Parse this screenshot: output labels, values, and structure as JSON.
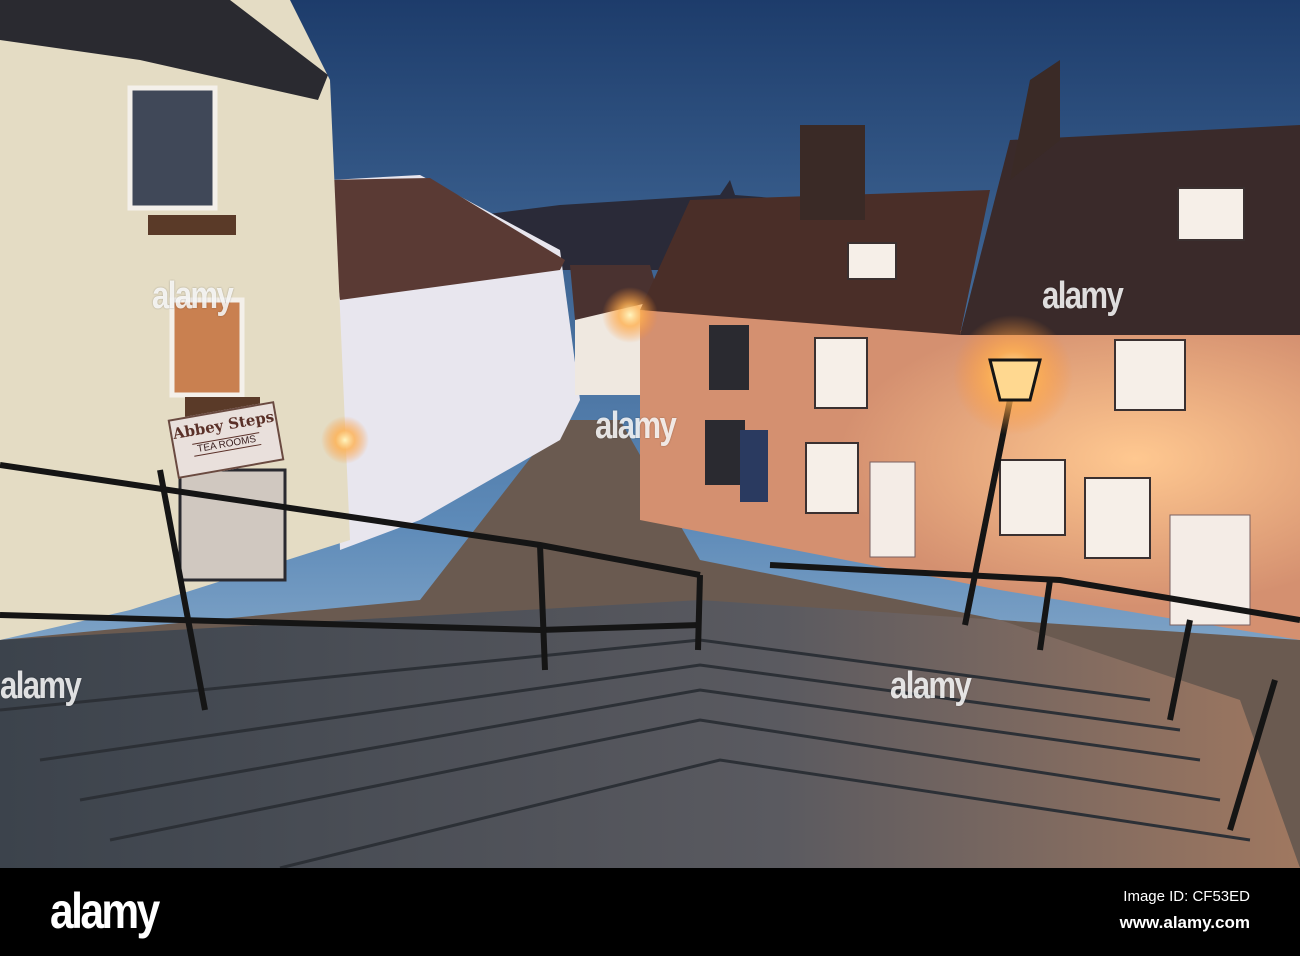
{
  "photo": {
    "sign": {
      "line1": "Abbey Steps",
      "line2": "TEA ROOMS"
    },
    "watermark": "alamy",
    "colors": {
      "sky_top": "#1e3f6e",
      "sky_bottom": "#9cc0dc",
      "lamp_glow": "#ffb060",
      "steps": "#4a5058"
    }
  },
  "footer": {
    "logo": "alamy",
    "image_id": "Image ID: CF53ED",
    "website": "www.alamy.com"
  }
}
